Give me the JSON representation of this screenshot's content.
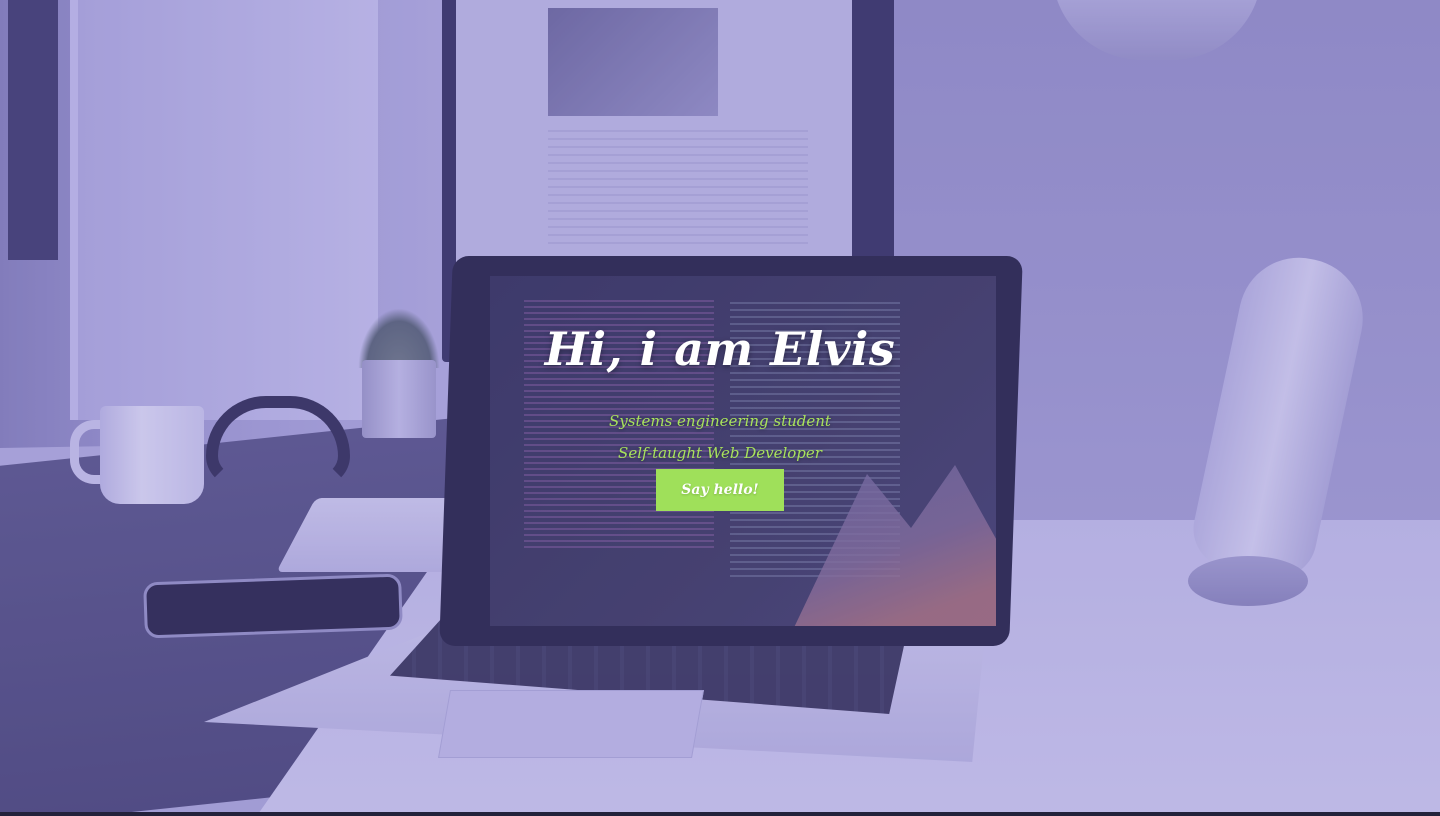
{
  "hero": {
    "title": "Hi, i am Elvis",
    "subtitles": [
      "Systems engineering student",
      "Self-taught Web Developer"
    ],
    "cta_label": "Say hello!"
  },
  "colors": {
    "accent": "#9fe05a",
    "subtitle_text": "#a8e25c",
    "title_text": "#ffffff",
    "overlay": "#6f63c4"
  }
}
